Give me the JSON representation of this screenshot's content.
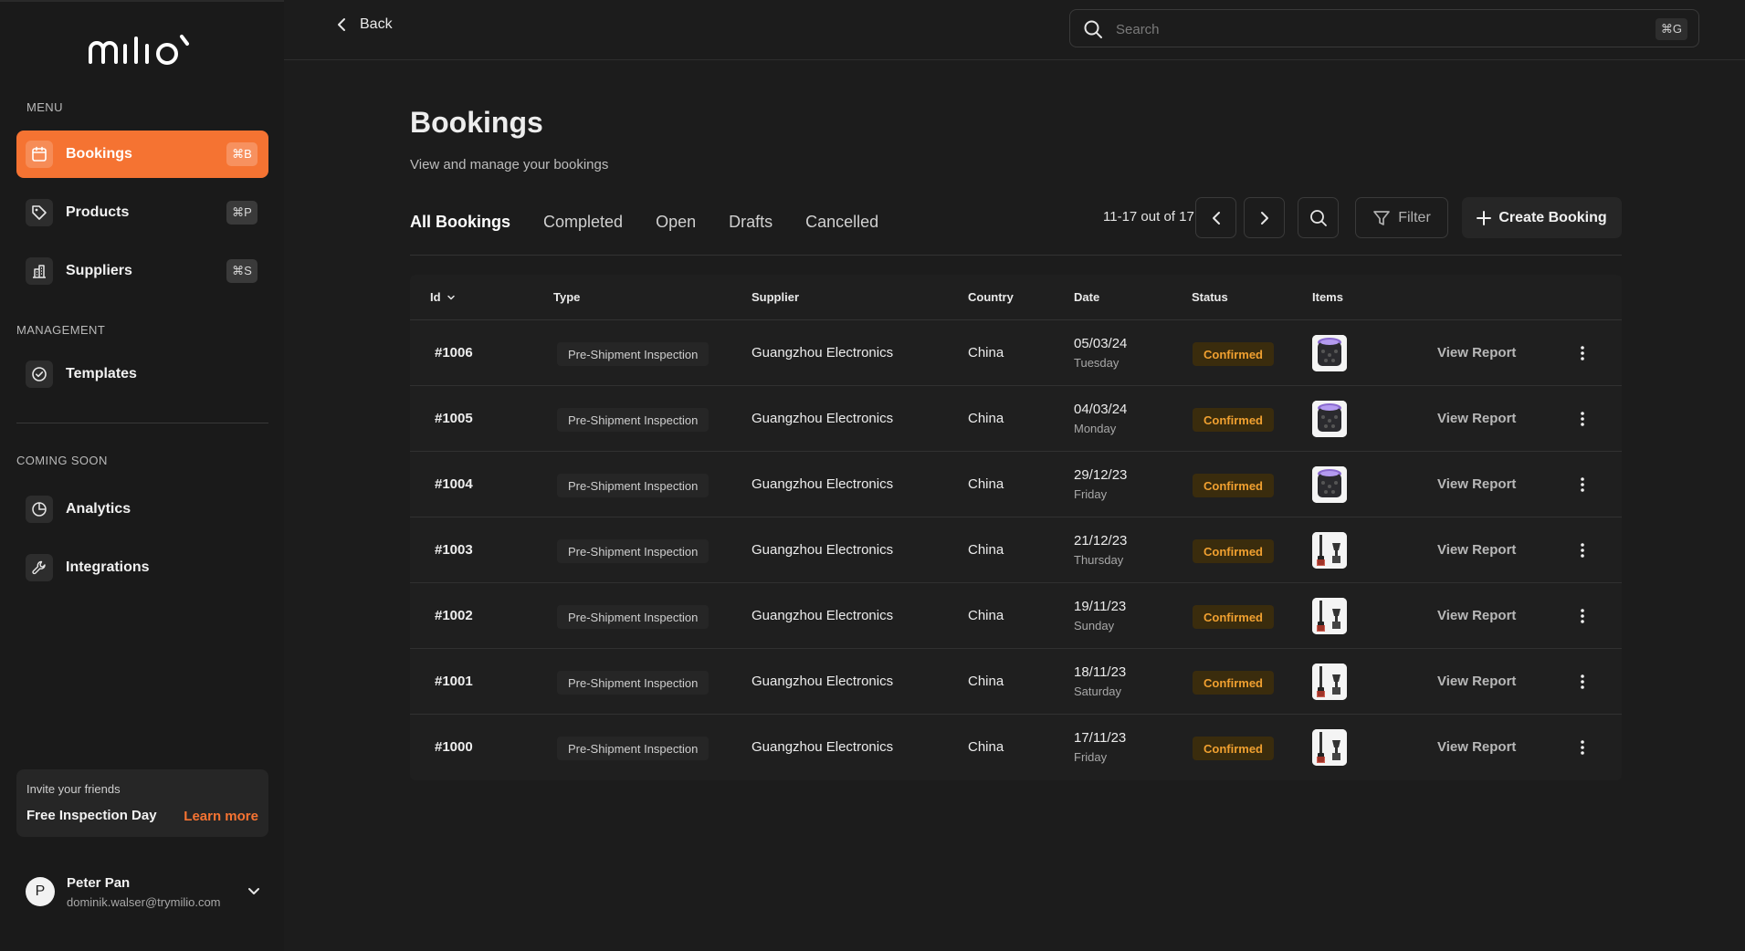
{
  "app": {
    "brand": "milio"
  },
  "sidebar": {
    "menu_label": "MENU",
    "menu_items": [
      {
        "label": "Bookings",
        "shortcut": "⌘B",
        "icon": "calendar-icon",
        "active": true
      },
      {
        "label": "Products",
        "shortcut": "⌘P",
        "icon": "tag-icon",
        "active": false
      },
      {
        "label": "Suppliers",
        "shortcut": "⌘S",
        "icon": "building-icon",
        "active": false
      }
    ],
    "management_label": "MANAGEMENT",
    "management_items": [
      {
        "label": "Templates",
        "icon": "check-circle-icon"
      }
    ],
    "coming_soon_label": "COMING SOON",
    "coming_soon_items": [
      {
        "label": "Analytics",
        "icon": "pie-chart-icon"
      },
      {
        "label": "Integrations",
        "icon": "wrench-icon"
      }
    ],
    "invite": {
      "small": "Invite your friends",
      "title": "Free Inspection Day",
      "link": "Learn more"
    },
    "user": {
      "initial": "P",
      "name": "Peter Pan",
      "email": "dominik.walser@trymilio.com"
    }
  },
  "topbar": {
    "back_label": "Back",
    "search_placeholder": "Search",
    "search_shortcut": "⌘G"
  },
  "page": {
    "title": "Bookings",
    "subtitle": "View and manage your bookings"
  },
  "tabs": [
    {
      "label": "All Bookings",
      "active": true
    },
    {
      "label": "Completed",
      "active": false
    },
    {
      "label": "Open",
      "active": false
    },
    {
      "label": "Drafts",
      "active": false
    },
    {
      "label": "Cancelled",
      "active": false
    }
  ],
  "toolbar": {
    "pagination": "11-17 out of 17",
    "filter_label": "Filter",
    "create_label": "Create Booking"
  },
  "table": {
    "columns": [
      "Id",
      "Type",
      "Supplier",
      "Country",
      "Date",
      "Status",
      "Items"
    ],
    "sort_column": "Id",
    "rows": [
      {
        "id": "#1006",
        "type": "Pre-Shipment Inspection",
        "supplier": "Guangzhou Electronics",
        "country": "China",
        "date": "05/03/24",
        "day": "Tuesday",
        "status": "Confirmed",
        "item": "speaker",
        "action": "View Report"
      },
      {
        "id": "#1005",
        "type": "Pre-Shipment Inspection",
        "supplier": "Guangzhou Electronics",
        "country": "China",
        "date": "04/03/24",
        "day": "Monday",
        "status": "Confirmed",
        "item": "speaker",
        "action": "View Report"
      },
      {
        "id": "#1004",
        "type": "Pre-Shipment Inspection",
        "supplier": "Guangzhou Electronics",
        "country": "China",
        "date": "29/12/23",
        "day": "Friday",
        "status": "Confirmed",
        "item": "speaker",
        "action": "View Report"
      },
      {
        "id": "#1003",
        "type": "Pre-Shipment Inspection",
        "supplier": "Guangzhou Electronics",
        "country": "China",
        "date": "21/12/23",
        "day": "Thursday",
        "status": "Confirmed",
        "item": "blender",
        "action": "View Report"
      },
      {
        "id": "#1002",
        "type": "Pre-Shipment Inspection",
        "supplier": "Guangzhou Electronics",
        "country": "China",
        "date": "19/11/23",
        "day": "Sunday",
        "status": "Confirmed",
        "item": "blender",
        "action": "View Report"
      },
      {
        "id": "#1001",
        "type": "Pre-Shipment Inspection",
        "supplier": "Guangzhou Electronics",
        "country": "China",
        "date": "18/11/23",
        "day": "Saturday",
        "status": "Confirmed",
        "item": "blender",
        "action": "View Report"
      },
      {
        "id": "#1000",
        "type": "Pre-Shipment Inspection",
        "supplier": "Guangzhou Electronics",
        "country": "China",
        "date": "17/11/23",
        "day": "Friday",
        "status": "Confirmed",
        "item": "blender",
        "action": "View Report"
      }
    ]
  },
  "colors": {
    "accent": "#f57332",
    "background": "#1c1c1c",
    "status_confirmed_text": "#f0a030",
    "status_confirmed_bg": "#3a2c0d"
  }
}
